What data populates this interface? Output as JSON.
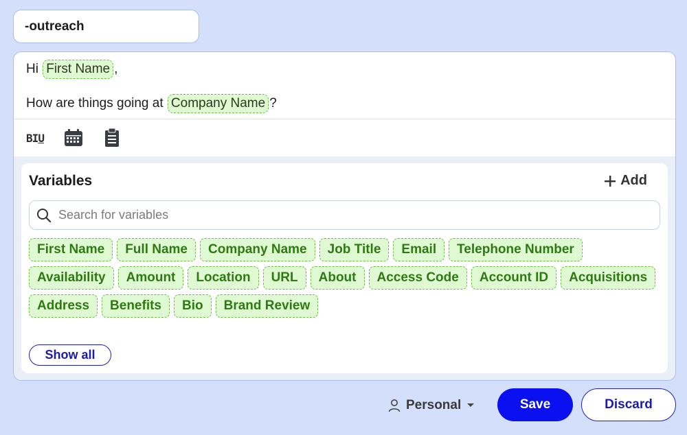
{
  "snippet": {
    "name": "-outreach"
  },
  "editor": {
    "line1": {
      "prefix": "Hi ",
      "variable": "First Name",
      "suffix": ","
    },
    "line2": {
      "prefix": "How are things going at ",
      "variable": "Company Name",
      "suffix": "?"
    },
    "toolbar": {
      "format_label": "BIU",
      "icons": [
        "text-format-icon",
        "calendar-icon",
        "clipboard-icon"
      ]
    }
  },
  "variables": {
    "title": "Variables",
    "add_label": "Add",
    "search_placeholder": "Search for variables",
    "chips": [
      "First Name",
      "Full Name",
      "Company Name",
      "Job Title",
      "Email",
      "Telephone Number",
      "Availability",
      "Amount",
      "Location",
      "URL",
      "About",
      "Access Code",
      "Account ID",
      "Acquisitions",
      "Address",
      "Benefits",
      "Bio",
      "Brand Review"
    ],
    "show_all_label": "Show all"
  },
  "footer": {
    "scope_label": "Personal",
    "save_label": "Save",
    "discard_label": "Discard"
  },
  "colors": {
    "background": "#d3dffb",
    "chip_bg": "#dff9d2",
    "chip_text": "#2e7a12",
    "primary": "#0a10f0"
  }
}
